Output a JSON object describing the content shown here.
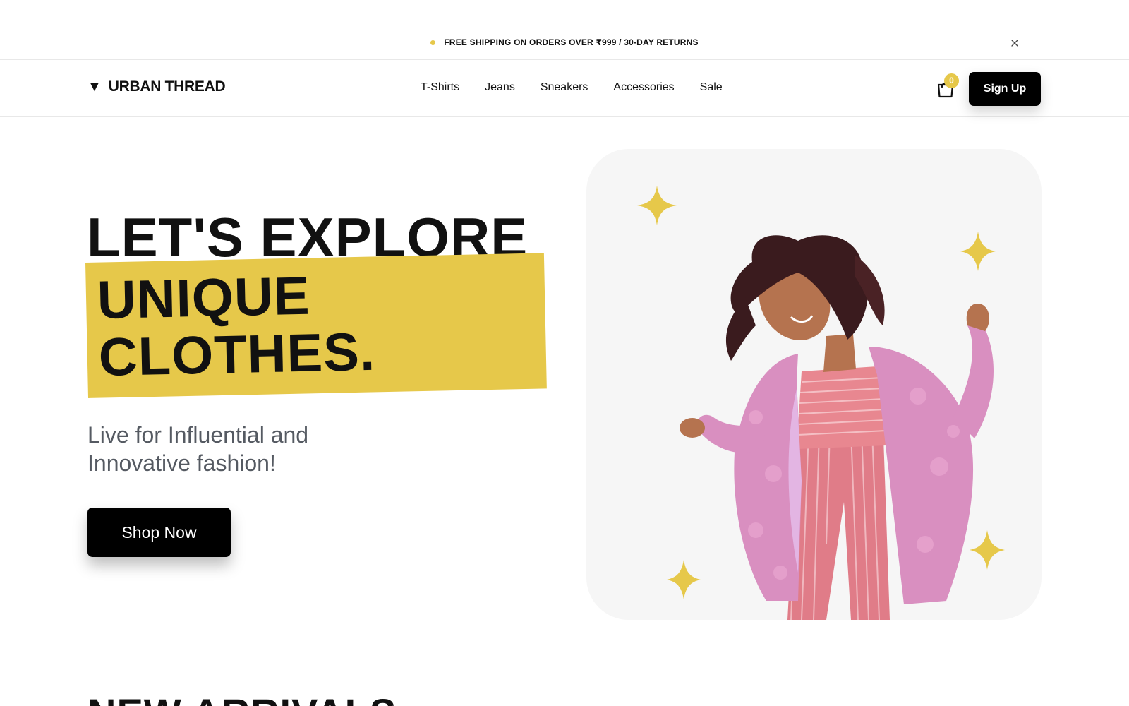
{
  "announcement": {
    "text": "FREE SHIPPING ON ORDERS OVER ₹999 / 30-DAY RETURNS",
    "close_icon": "close-icon",
    "dot_color": "#e6c84a"
  },
  "header": {
    "logo_text": "URBAN THREAD",
    "logo_icon": "▼",
    "nav": [
      "T-Shirts",
      "Jeans",
      "Sneakers",
      "Accessories",
      "Sale"
    ],
    "cart_count": "0",
    "signup_label": "Sign Up"
  },
  "hero": {
    "line1": "LET'S EXPLORE",
    "line2": "UNIQUE",
    "line3": "CLOTHES.",
    "subtitle": "Live for Influential and Innovative fashion!",
    "cta_label": "Shop Now",
    "accent_color": "#e6c84a"
  },
  "next_section": {
    "title": "NEW ARRIVALS"
  }
}
